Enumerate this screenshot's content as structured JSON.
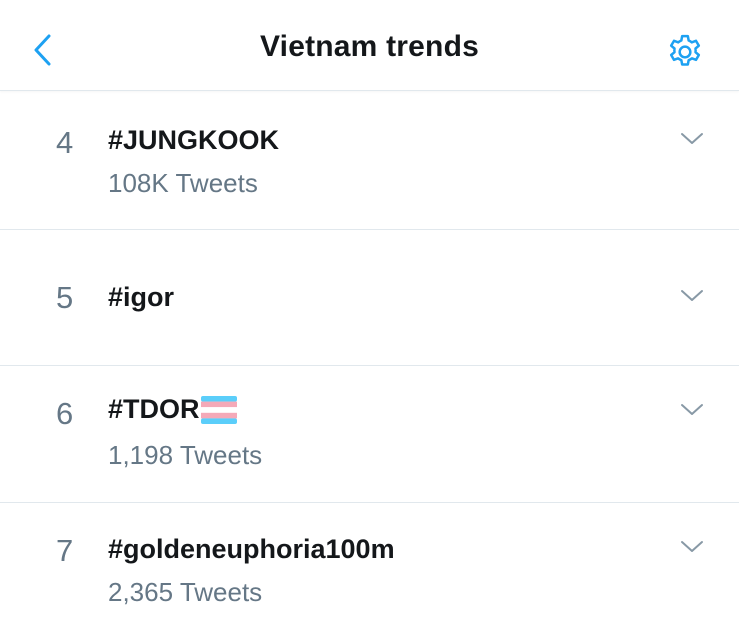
{
  "header": {
    "title": "Vietnam trends",
    "back_icon": "chevron-left-icon",
    "settings_icon": "gear-icon",
    "accent_color": "#1da1f2"
  },
  "trends": [
    {
      "rank": "4",
      "name": "#JUNGKOOK",
      "tweets": "108K Tweets"
    },
    {
      "rank": "5",
      "name": "#igor",
      "tweets": ""
    },
    {
      "rank": "6",
      "name": "#TDOR",
      "emoji": "transgender-flag",
      "tweets": "1,198 Tweets"
    },
    {
      "rank": "7",
      "name": "#goldeneuphoria100m",
      "tweets": "2,365 Tweets"
    }
  ],
  "colors": {
    "primary_text": "#14171a",
    "secondary_text": "#657786",
    "divider": "#e1e8ed",
    "chevron": "#8899a6",
    "flag_blue": "#5bcefa",
    "flag_pink": "#f5a9b8",
    "flag_white": "#ffffff"
  }
}
